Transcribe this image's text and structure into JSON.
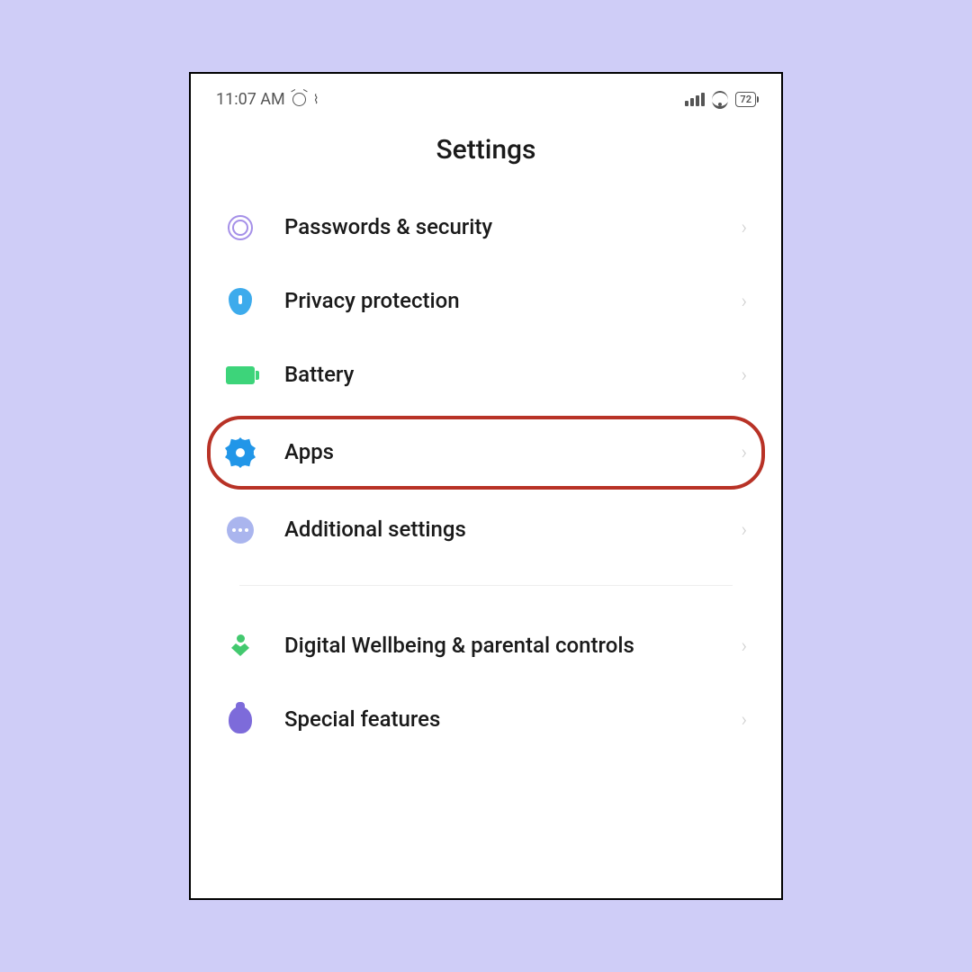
{
  "statusBar": {
    "time": "11:07 AM",
    "battery": "72"
  },
  "page": {
    "title": "Settings"
  },
  "sections": [
    {
      "items": [
        {
          "key": "passwords",
          "label": "Passwords & security",
          "icon": "fingerprint-icon",
          "highlighted": false
        },
        {
          "key": "privacy",
          "label": "Privacy protection",
          "icon": "shield-icon",
          "highlighted": false
        },
        {
          "key": "battery",
          "label": "Battery",
          "icon": "battery-icon",
          "highlighted": false
        },
        {
          "key": "apps",
          "label": "Apps",
          "icon": "gear-icon",
          "highlighted": true
        },
        {
          "key": "additional",
          "label": "Additional settings",
          "icon": "dots-icon",
          "highlighted": false
        }
      ]
    },
    {
      "items": [
        {
          "key": "wellbeing",
          "label": "Digital Wellbeing & parental controls",
          "icon": "heart-icon",
          "highlighted": false
        },
        {
          "key": "special",
          "label": "Special features",
          "icon": "bag-icon",
          "highlighted": false
        }
      ]
    }
  ],
  "annotation": {
    "highlightColor": "#b83226"
  }
}
